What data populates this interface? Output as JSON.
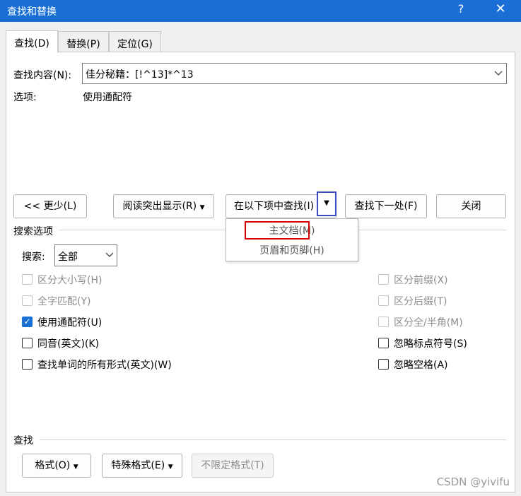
{
  "window": {
    "title": "查找和替换",
    "help": "?",
    "close": "✕"
  },
  "tabs": [
    {
      "label": "查找(D)"
    },
    {
      "label": "替换(P)"
    },
    {
      "label": "定位(G)"
    }
  ],
  "find": {
    "label": "查找内容(N):",
    "value": "佳分秘籍：[!^13]*^13",
    "options_label": "选项:",
    "options_value": "使用通配符"
  },
  "buttons": {
    "less": "<< 更少(L)",
    "reading_highlight": "阅读突出显示(R)",
    "find_in": "在以下项中查找(I)",
    "find_next": "查找下一处(F)",
    "close": "关闭"
  },
  "find_in_menu": {
    "items": [
      "主文档(M)",
      "页眉和页脚(H)"
    ]
  },
  "search_options": {
    "title": "搜索选项",
    "search_label": "搜索:",
    "search_value": "全部"
  },
  "checkboxes_left": [
    {
      "label": "区分大小写(H)",
      "checked": false,
      "disabled": true
    },
    {
      "label": "全字匹配(Y)",
      "checked": false,
      "disabled": true
    },
    {
      "label": "使用通配符(U)",
      "checked": true,
      "disabled": false
    },
    {
      "label": "同音(英文)(K)",
      "checked": false,
      "disabled": false
    },
    {
      "label": "查找单词的所有形式(英文)(W)",
      "checked": false,
      "disabled": false
    }
  ],
  "checkboxes_right": [
    {
      "label": "区分前缀(X)",
      "checked": false,
      "disabled": true
    },
    {
      "label": "区分后缀(T)",
      "checked": false,
      "disabled": true
    },
    {
      "label": "区分全/半角(M)",
      "checked": false,
      "disabled": true
    },
    {
      "label": "忽略标点符号(S)",
      "checked": false,
      "disabled": false
    },
    {
      "label": "忽略空格(A)",
      "checked": false,
      "disabled": false
    }
  ],
  "find_section": {
    "title": "查找",
    "format": "格式(O)",
    "special": "特殊格式(E)",
    "no_format": "不限定格式(T)"
  },
  "watermark": "CSDN @yivifu",
  "colors": {
    "titlebar": "#1a6fd6",
    "highlight_red": "#d80000",
    "focus_blue": "#3c46c8"
  }
}
